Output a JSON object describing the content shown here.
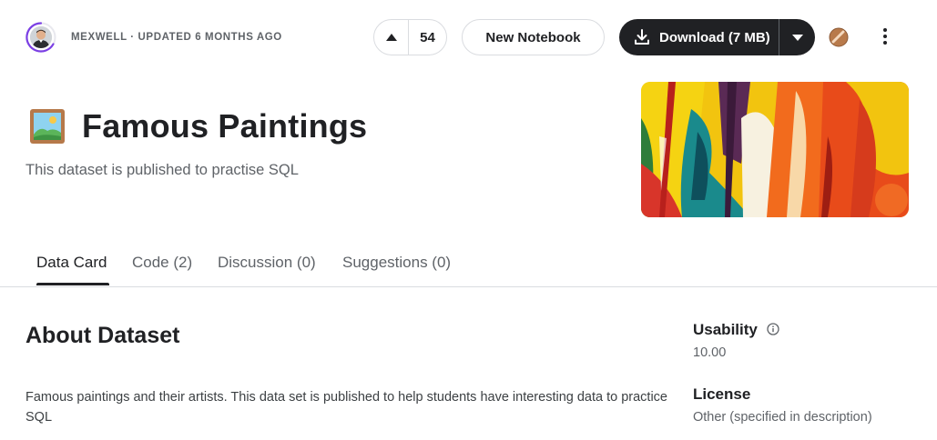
{
  "header": {
    "author": "MEXWELL",
    "separator": " · ",
    "updated": "UPDATED 6 MONTHS AGO",
    "vote_count": "54",
    "new_notebook_label": "New Notebook",
    "download_label": "Download (7 MB)",
    "icons": {
      "upvote": "triangle-up-icon",
      "download": "download-icon",
      "caret": "chevron-down-icon",
      "more": "more-vertical-icon"
    }
  },
  "dataset": {
    "title": "Famous Paintings",
    "subtitle": "This dataset is published to practise SQL",
    "title_icon": "framed-picture-icon"
  },
  "tabs": [
    {
      "label": "Data Card",
      "active": true
    },
    {
      "label": "Code (2)",
      "active": false
    },
    {
      "label": "Discussion (0)",
      "active": false
    },
    {
      "label": "Suggestions (0)",
      "active": false
    }
  ],
  "about": {
    "heading": "About Dataset",
    "text": "Famous paintings and their artists. This data set is published to help students have interesting data to practice SQL"
  },
  "sidebar": {
    "usability_label": "Usability",
    "usability_value": "10.00",
    "license_label": "License",
    "license_value": "Other (specified in description)"
  },
  "colors": {
    "primary_dark": "#202124",
    "muted_text": "#5f6368",
    "border": "#dadce0",
    "avatar_ring": "#7b3fe4"
  }
}
